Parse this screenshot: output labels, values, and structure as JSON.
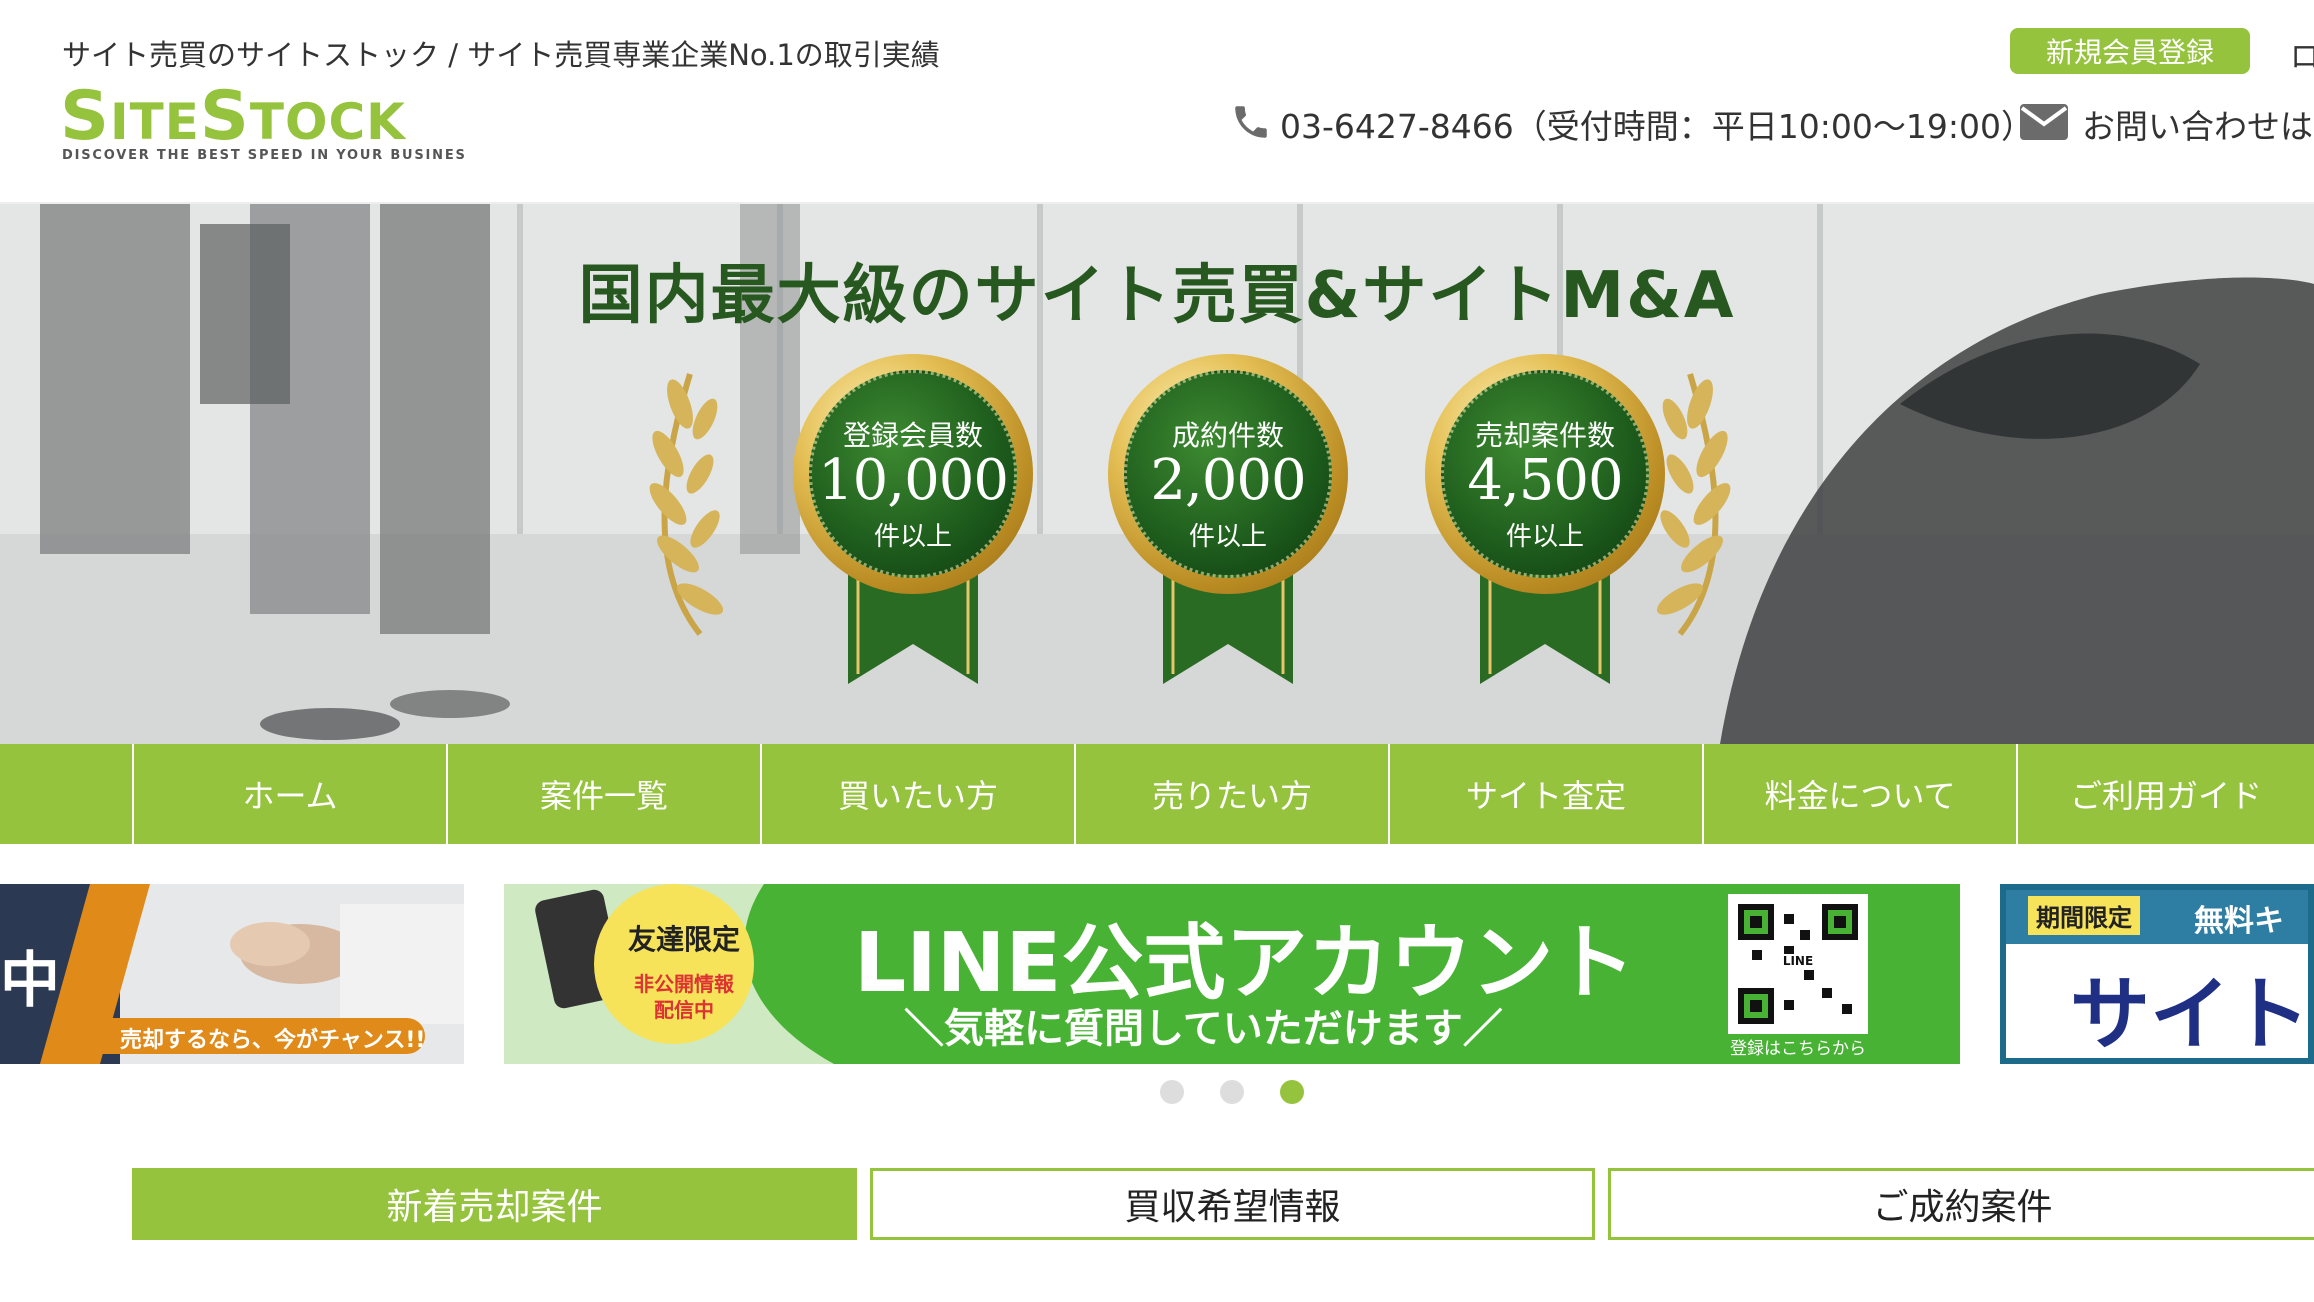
{
  "header": {
    "tagline": "サイト売買のサイトストック / サイト売買専業企業No.1の取引実績",
    "logo_title_big1": "S",
    "logo_title_sm1": "ITE",
    "logo_title_big2": "S",
    "logo_title_sm2": "TOCK",
    "logo_subtitle": "DISCOVER THE BEST SPEED IN YOUR BUSINES",
    "register_label": "新規会員登録",
    "login_label_cut": "ロ",
    "phone_text": "03-6427-8466（受付時間：平日10:00〜19:00）",
    "contact_text": "お問い合わせは",
    "icons": {
      "phone": "phone-icon",
      "mail": "mail-icon"
    }
  },
  "hero": {
    "title": "国内最大級のサイト売買&サイトM&A",
    "medals": [
      {
        "label": "登録会員数",
        "value": "10,000",
        "unit": "件以上"
      },
      {
        "label": "成約件数",
        "value": "2,000",
        "unit": "件以上"
      },
      {
        "label": "売却案件数",
        "value": "4,500",
        "unit": "件以上"
      }
    ]
  },
  "nav": {
    "items": [
      {
        "label": "ホーム"
      },
      {
        "label": "案件一覧"
      },
      {
        "label": "買いたい方"
      },
      {
        "label": "売りたい方"
      },
      {
        "label": "サイト査定"
      },
      {
        "label": "料金について"
      },
      {
        "label": "ご利用ガイド"
      }
    ]
  },
  "carousel": {
    "left": {
      "label_cut": "中",
      "caption": "売却するなら、今がチャンス!!"
    },
    "center": {
      "badge_line1": "友達限定",
      "badge_line2": "非公開情報",
      "badge_line3": "配信中",
      "title": "LINE公式アカウント",
      "subtitle": "＼気軽に質問していただけます／",
      "qr_caption": "登録はこちらから",
      "qr_label": "LINE"
    },
    "right": {
      "badge1": "期間限定",
      "badge2": "無料キ",
      "title_cut": "サイト"
    },
    "active_slide": 3,
    "slide_count": 3
  },
  "tabs": [
    {
      "label": "新着売却案件",
      "active": true
    },
    {
      "label": "買収希望情報",
      "active": false
    },
    {
      "label": "ご成約案件",
      "active": false
    }
  ],
  "colors": {
    "brand_green": "#95c33d",
    "hero_title": "#27581f",
    "line_green": "#48b234"
  }
}
